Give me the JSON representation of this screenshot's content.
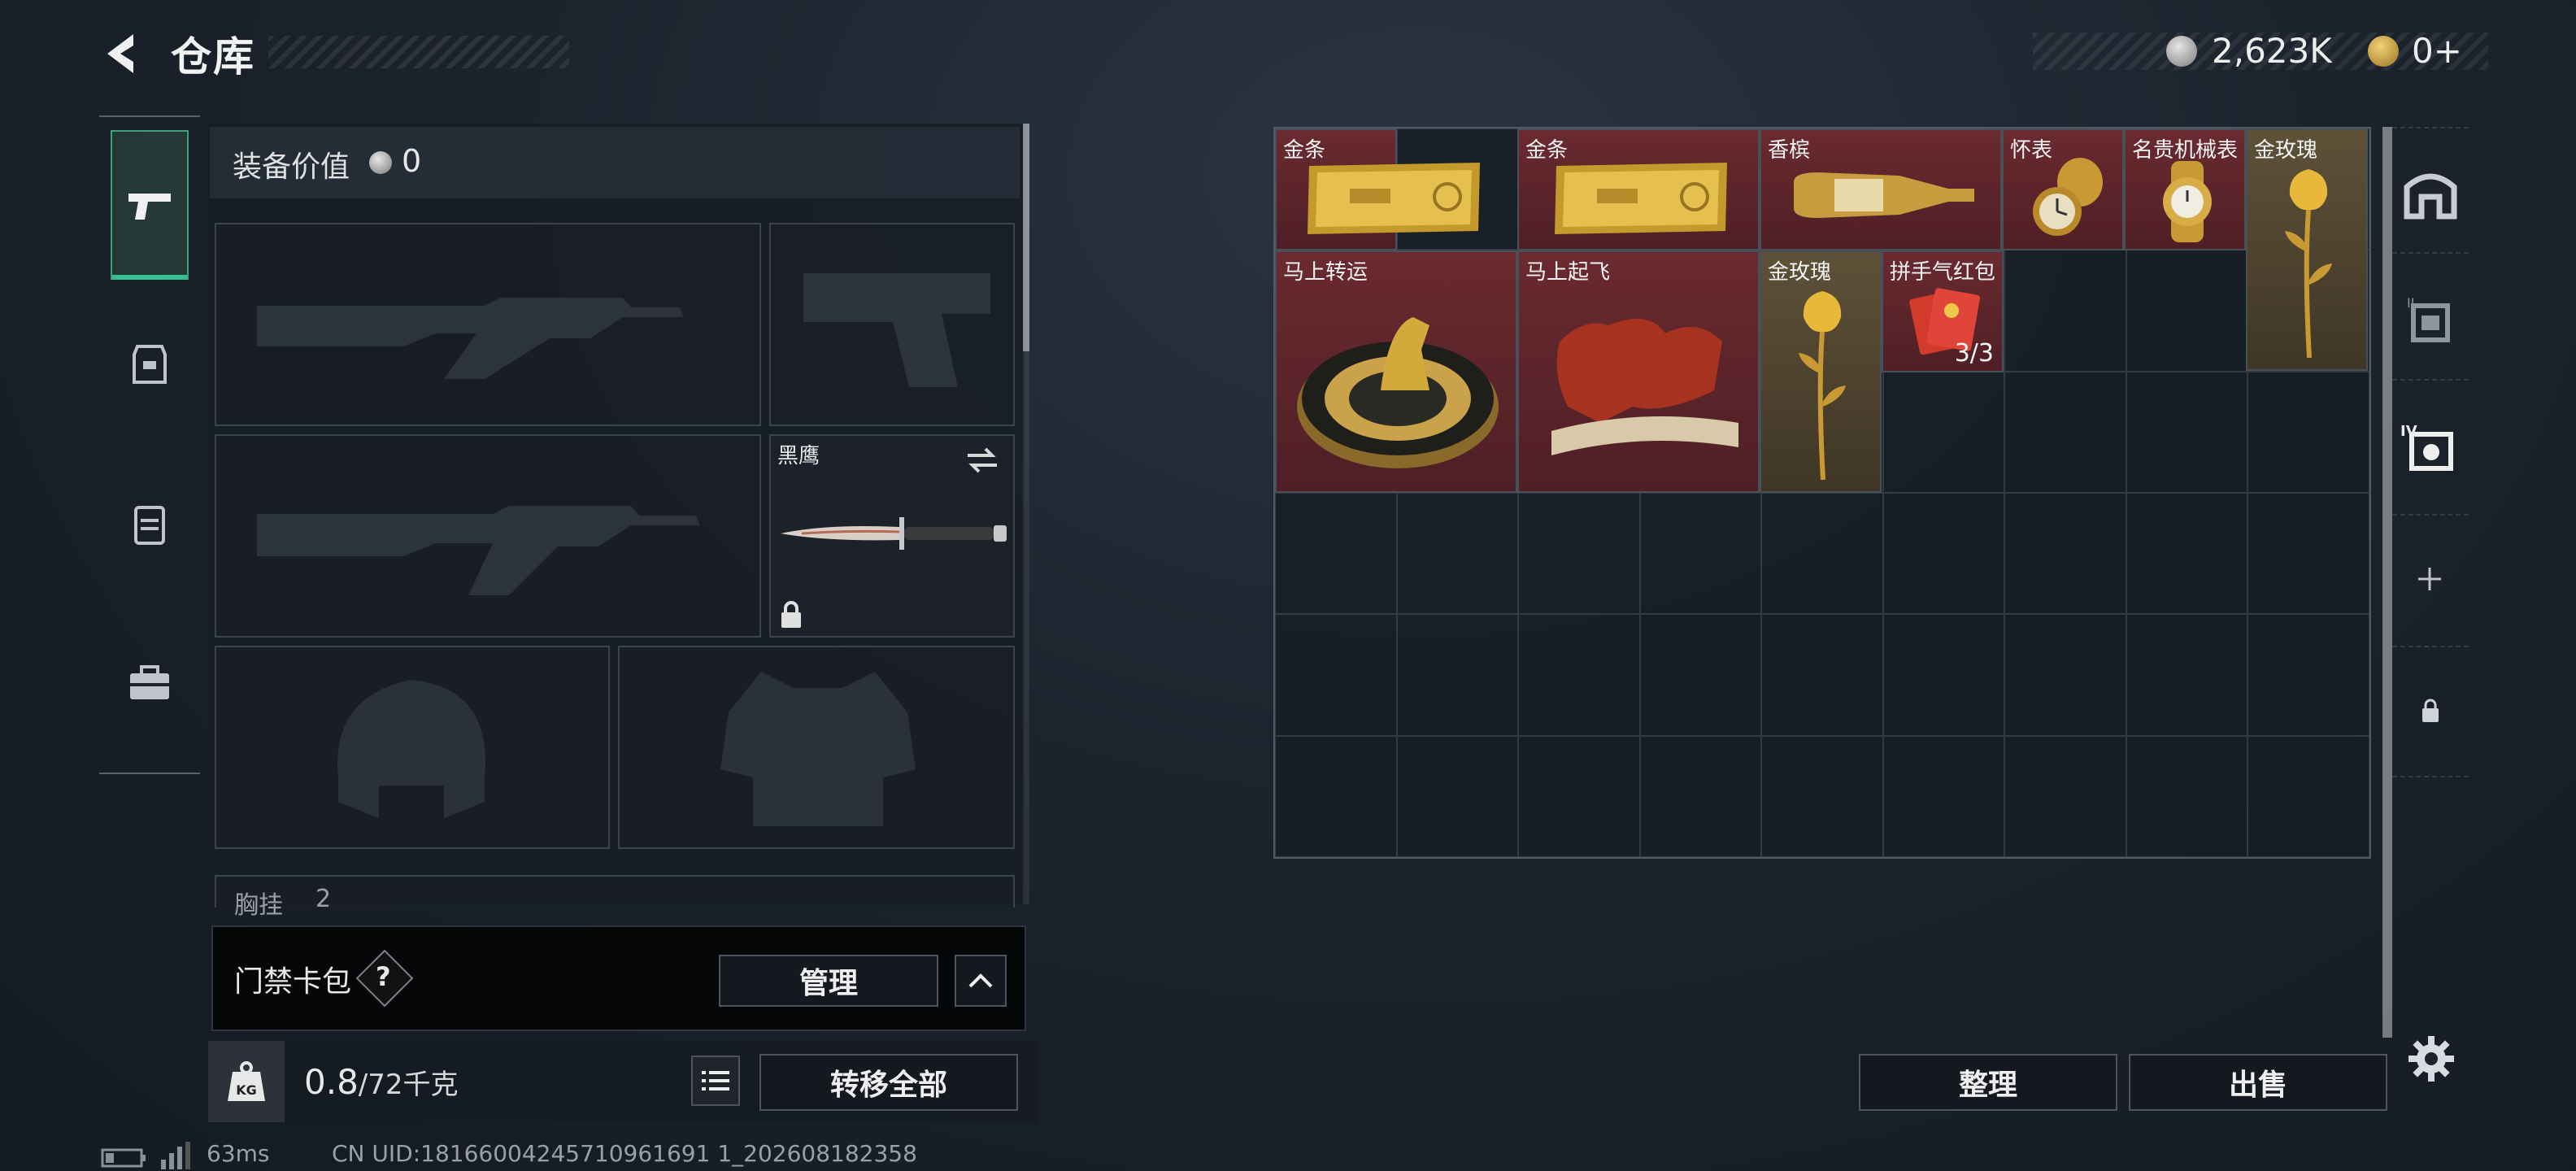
{
  "header": {
    "title": "仓库"
  },
  "currency": {
    "silver": "2,623K",
    "gold": "0+"
  },
  "equipment": {
    "value_label": "装备价值",
    "value": "0",
    "melee_name": "黑鹰",
    "chest_rig_label": "胸挂",
    "chest_rig_count": "2"
  },
  "keycard": {
    "label": "门禁卡包",
    "help": "?",
    "manage": "管理"
  },
  "weight": {
    "current": "0.8",
    "capacity": "/72千克"
  },
  "actions": {
    "transfer_all": "转移全部",
    "organize": "整理",
    "sell": "出售"
  },
  "items": [
    {
      "name": "金条"
    },
    {
      "name": "金条"
    },
    {
      "name": "香槟"
    },
    {
      "name": "怀表"
    },
    {
      "name": "名贵机械表"
    },
    {
      "name": "金玫瑰"
    },
    {
      "name": "马上转运"
    },
    {
      "name": "马上起飞"
    },
    {
      "name": "金玫瑰"
    },
    {
      "name": "拼手气红包",
      "count": "3/3"
    }
  ],
  "status": {
    "ping": "63ms",
    "uid": "CN UID:18166004245710961691 1_202608182358"
  },
  "colors": {
    "accent": "#39c291",
    "rare_red": "#5e2429",
    "legendary_gold": "#5a4c34"
  }
}
